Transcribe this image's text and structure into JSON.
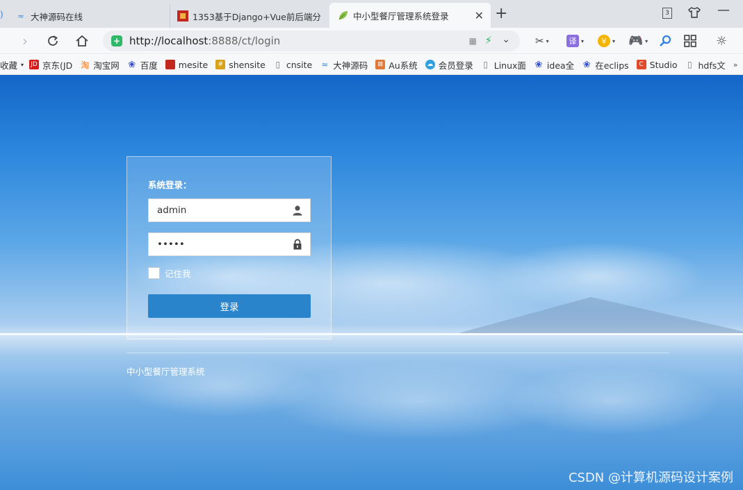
{
  "browser": {
    "tabs": [
      {
        "title": "大神源码在线",
        "icon": "wave-icon"
      },
      {
        "title": "1353基于Django+Vue前后端分",
        "icon": "site-favicon"
      },
      {
        "title": "中小型餐厅管理系统登录",
        "icon": "leaf-icon",
        "active": true
      }
    ],
    "close_glyph": "✕",
    "new_tab_glyph": "+",
    "window_tab_count": "3",
    "url_host": "http://localhost",
    "url_rest": ":8888/ct/login",
    "security_glyph": "+",
    "translate_glyph": "译",
    "coin_glyph": "¥"
  },
  "bookmarks": [
    {
      "label": "收藏",
      "icon": "none"
    },
    {
      "label": "京东(JD",
      "icon": "JD"
    },
    {
      "label": "淘宝网",
      "icon": "淘"
    },
    {
      "label": "百度",
      "icon": "paw"
    },
    {
      "label": "mesite",
      "icon": "red"
    },
    {
      "label": "shensite",
      "icon": "gold"
    },
    {
      "label": "cnsite",
      "icon": "doc"
    },
    {
      "label": "大神源码",
      "icon": "wave"
    },
    {
      "label": "Au系统",
      "icon": "au"
    },
    {
      "label": "会员登录",
      "icon": "hy"
    },
    {
      "label": "Linux面",
      "icon": "doc"
    },
    {
      "label": "idea全",
      "icon": "paw"
    },
    {
      "label": "在eclips",
      "icon": "paw"
    },
    {
      "label": "Studio",
      "icon": "C"
    },
    {
      "label": "hdfs文",
      "icon": "doc"
    }
  ],
  "login": {
    "title": "系统登录：",
    "username": "admin",
    "password": "•••••",
    "remember_label": "记住我",
    "submit_label": "登录"
  },
  "footer": {
    "system_name": "中小型餐厅管理系统"
  },
  "watermark": "CSDN @计算机源码设计案例",
  "colors": {
    "login_button": "#2a84cc",
    "sky_top": "#1466c8"
  }
}
